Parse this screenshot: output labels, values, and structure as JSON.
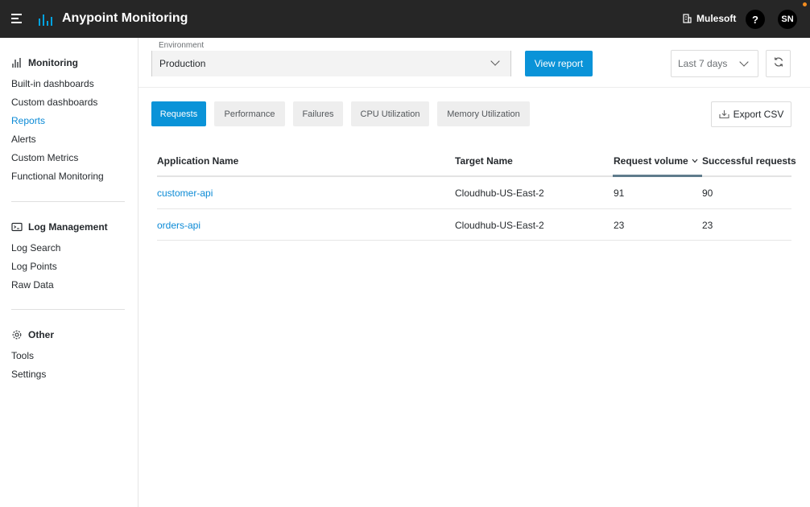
{
  "header": {
    "app_title": "Anypoint Monitoring",
    "org_name": "Mulesoft",
    "help_label": "?",
    "user_initials": "SN"
  },
  "sidebar": {
    "monitoring": {
      "title": "Monitoring",
      "items": [
        "Built-in dashboards",
        "Custom dashboards",
        "Reports",
        "Alerts",
        "Custom Metrics",
        "Functional Monitoring"
      ]
    },
    "log_management": {
      "title": "Log Management",
      "items": [
        "Log Search",
        "Log Points",
        "Raw Data"
      ]
    },
    "other": {
      "title": "Other",
      "items": [
        "Tools",
        "Settings"
      ]
    },
    "active_item": "Reports"
  },
  "toolbar": {
    "environment_label": "Environment",
    "environment_value": "Production",
    "view_report_label": "View report",
    "date_range_value": "Last 7 days"
  },
  "tabs": [
    "Requests",
    "Performance",
    "Failures",
    "CPU Utilization",
    "Memory Utilization"
  ],
  "active_tab": "Requests",
  "export_label": "Export CSV",
  "table": {
    "headers": [
      "Application Name",
      "Target Name",
      "Request volume",
      "Successful requests"
    ],
    "rows": [
      [
        "customer-api",
        "Cloudhub-US-East-2",
        "91",
        "90"
      ],
      [
        "orders-api",
        "Cloudhub-US-East-2",
        "23",
        "23"
      ]
    ]
  },
  "colors": {
    "topbar": "#262626",
    "accent": "#0a93d8",
    "link": "#0b8ad6"
  }
}
